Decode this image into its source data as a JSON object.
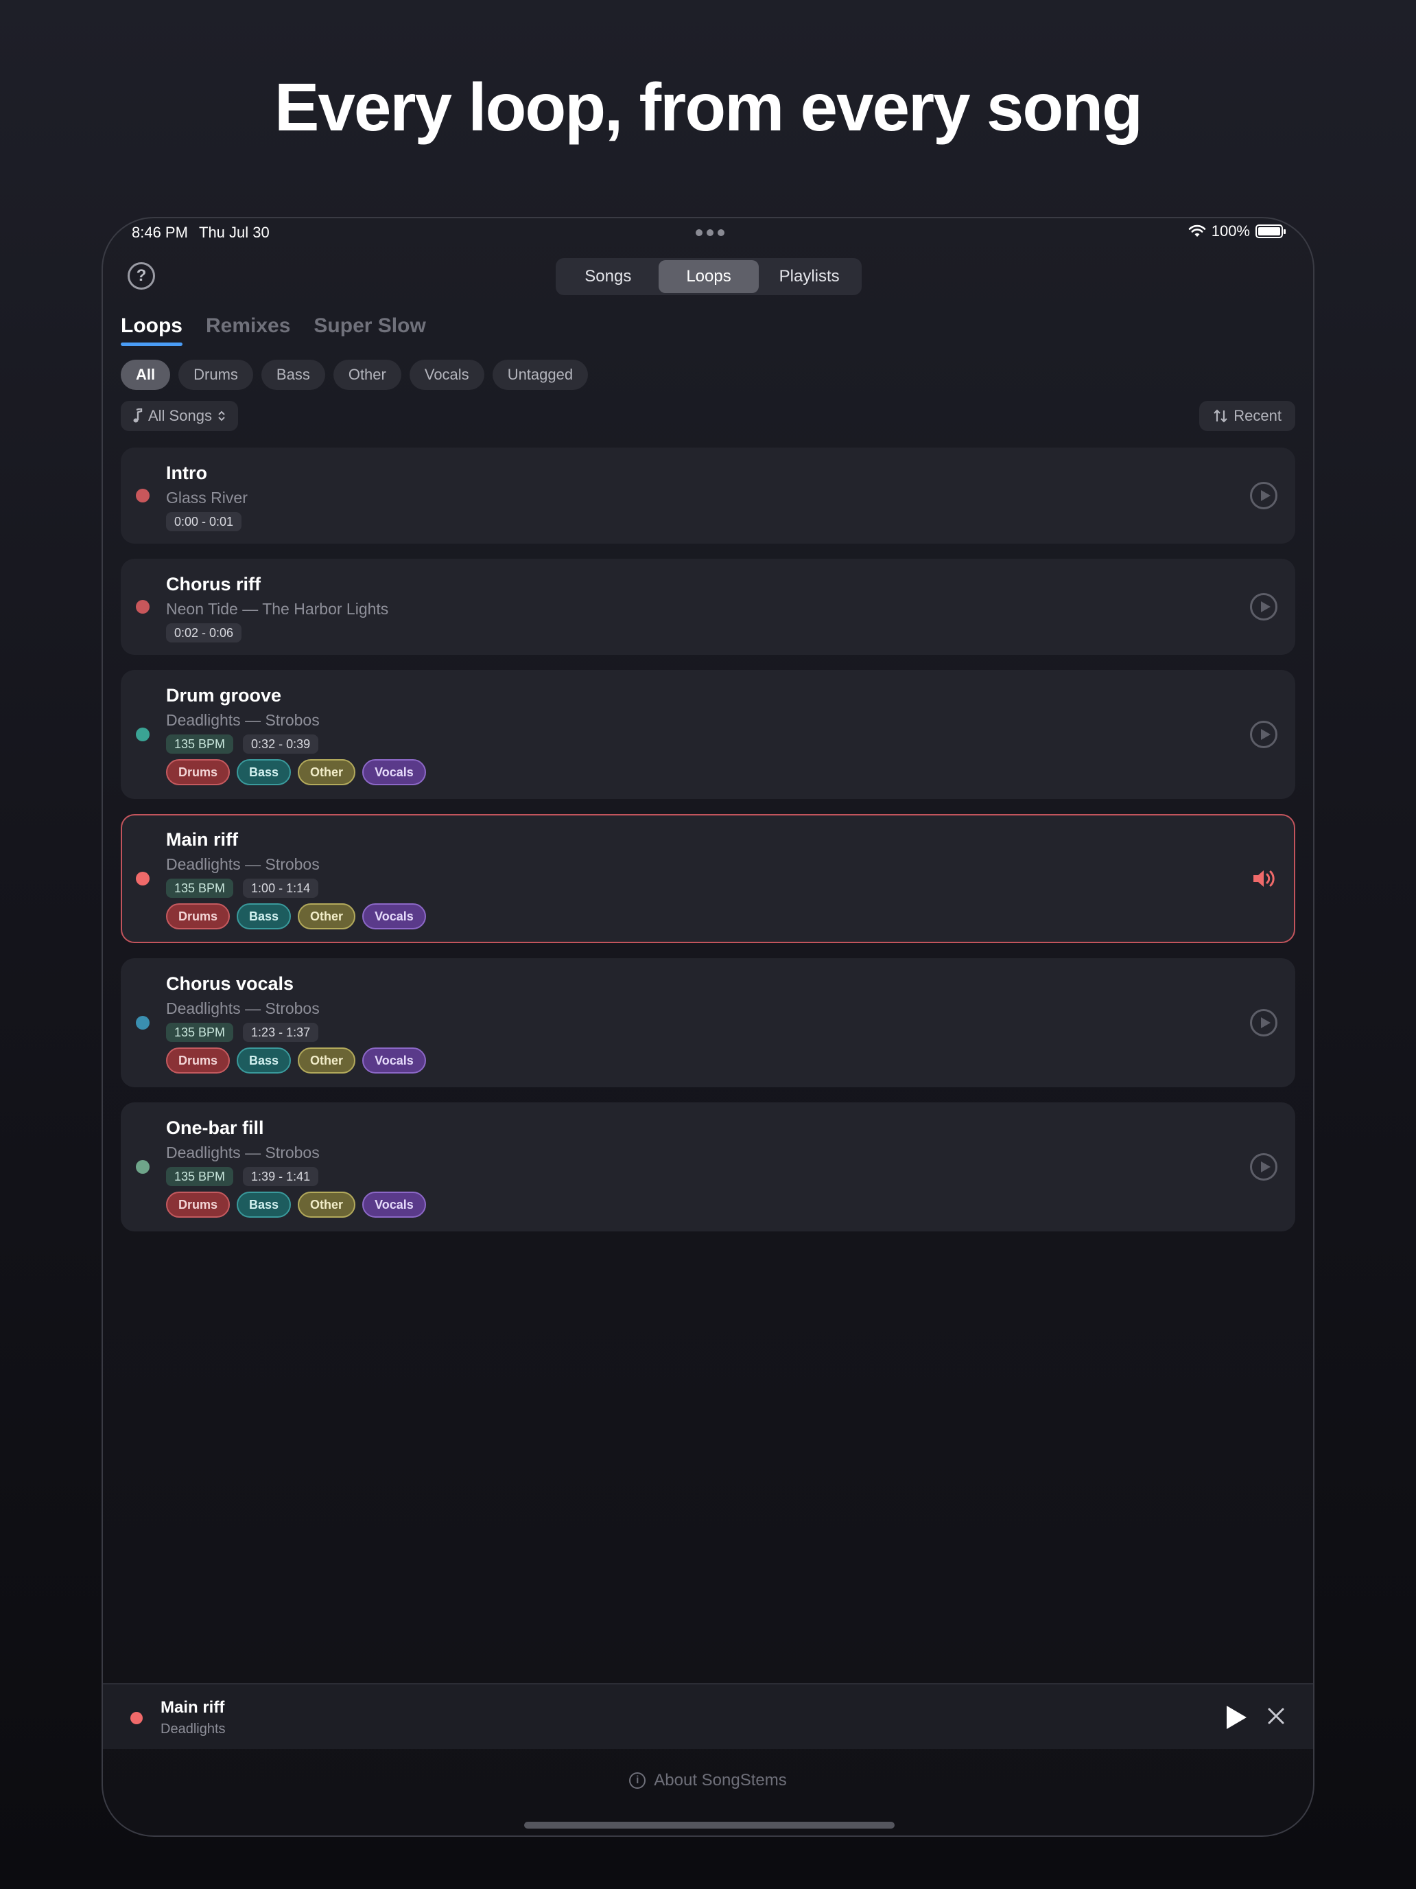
{
  "headline": "Every loop, from every song",
  "status_bar": {
    "time": "8:46 PM",
    "date": "Thu Jul 30",
    "battery": "100%"
  },
  "segmented": {
    "items": [
      "Songs",
      "Loops",
      "Playlists"
    ],
    "selected": "Loops"
  },
  "subtabs": {
    "items": [
      "Loops",
      "Remixes",
      "Super Slow"
    ],
    "selected": "Loops",
    "accent": "#4a9cf5"
  },
  "filters": {
    "items": [
      "All",
      "Drums",
      "Bass",
      "Other",
      "Vocals",
      "Untagged"
    ],
    "selected": "All"
  },
  "song_filter": {
    "label": "All Songs",
    "icon": "music-note-icon"
  },
  "sort": {
    "label": "Recent",
    "icon": "sort-arrows-icon"
  },
  "loops": [
    {
      "title": "Intro",
      "subtitle": "Glass River",
      "bpm": "",
      "range": "0:00 - 0:01",
      "tags": [],
      "dot_color": "#c8575b",
      "playing": false
    },
    {
      "title": "Chorus riff",
      "subtitle": "Neon Tide — The Harbor Lights",
      "bpm": "",
      "range": "0:02 - 0:06",
      "tags": [],
      "dot_color": "#c8575b",
      "playing": false
    },
    {
      "title": "Drum groove",
      "subtitle": "Deadlights — Strobos",
      "bpm": "135 BPM",
      "range": "0:32 - 0:39",
      "tags": [
        "Drums",
        "Bass",
        "Other",
        "Vocals"
      ],
      "dot_color": "#3aa394",
      "playing": false
    },
    {
      "title": "Main riff",
      "subtitle": "Deadlights — Strobos",
      "bpm": "135 BPM",
      "range": "1:00 - 1:14",
      "tags": [
        "Drums",
        "Bass",
        "Other",
        "Vocals"
      ],
      "dot_color": "#f06a6a",
      "playing": true
    },
    {
      "title": "Chorus vocals",
      "subtitle": "Deadlights — Strobos",
      "bpm": "135 BPM",
      "range": "1:23 - 1:37",
      "tags": [
        "Drums",
        "Bass",
        "Other",
        "Vocals"
      ],
      "dot_color": "#3a8fb0",
      "playing": false
    },
    {
      "title": "One-bar fill",
      "subtitle": "Deadlights — Strobos",
      "bpm": "135 BPM",
      "range": "1:39 - 1:41",
      "tags": [
        "Drums",
        "Bass",
        "Other",
        "Vocals"
      ],
      "dot_color": "#6fa58a",
      "playing": false
    }
  ],
  "mini_player": {
    "title": "Main riff",
    "subtitle": "Deadlights",
    "dot_color": "#f06a6a"
  },
  "footer": {
    "about_label": "About SongStems"
  },
  "colors": {
    "playing_border": "#c2545c",
    "speaker": "#f06a6a"
  }
}
